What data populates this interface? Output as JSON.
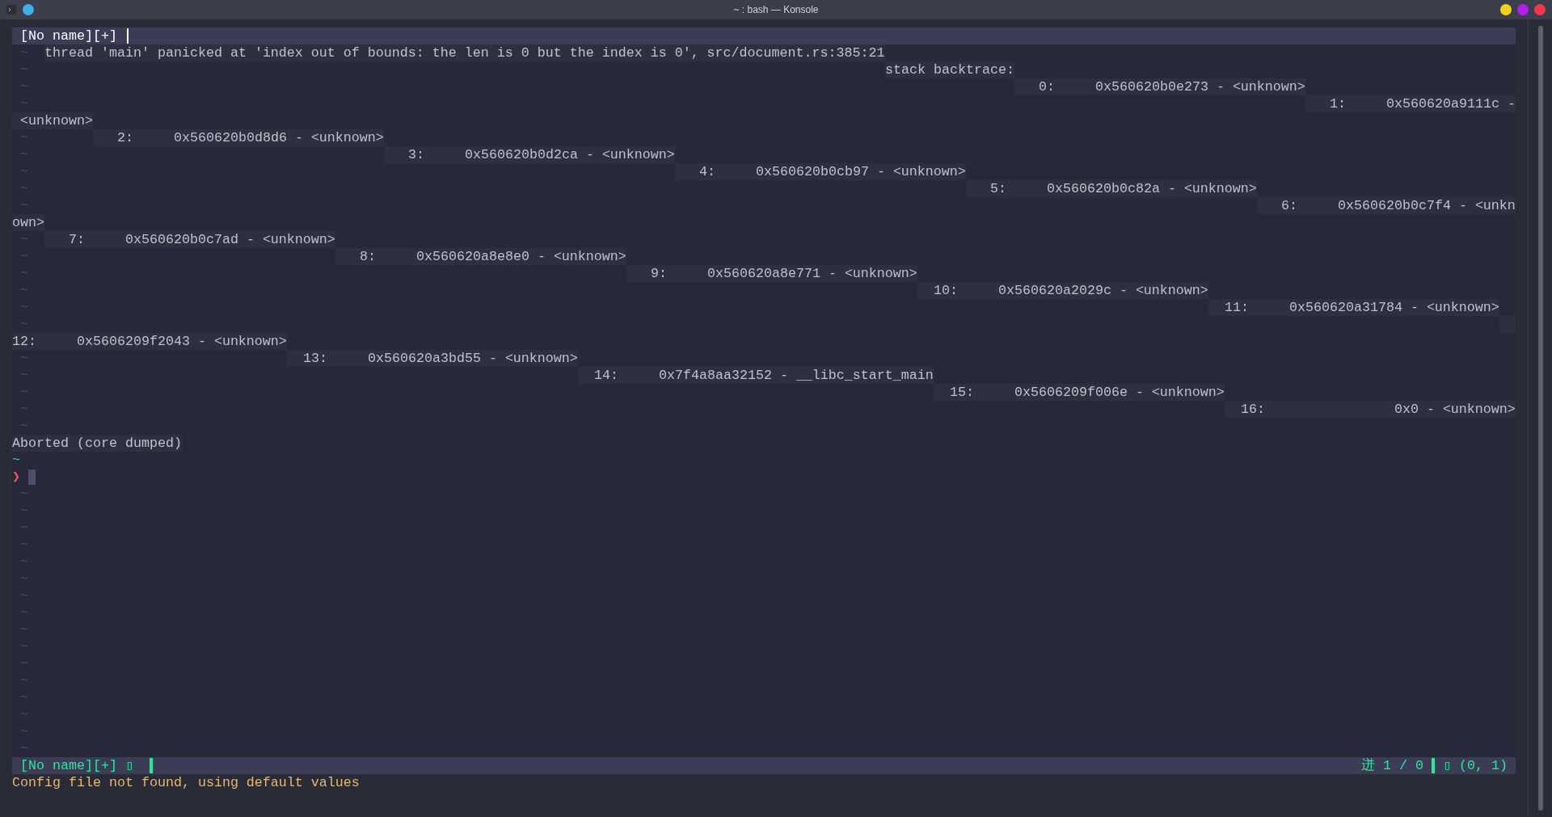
{
  "window": {
    "title": "~ : bash — Konsole"
  },
  "editor": {
    "tab": "[No name][+]",
    "rows": [
      {
        "tilde": "~",
        "output": "thread 'main' panicked at 'index out of bounds: the len is 0 but the index is 0', src/document.rs:385:21"
      },
      {
        "tilde": "~",
        "output": "stack backtrace:"
      },
      {
        "tilde": "~",
        "output": "   0:     0x560620b0e273 - <unknown>"
      },
      {
        "tilde": "~",
        "output": "   1:     0x560620a9111c -"
      },
      {
        "output": " <unknown>"
      },
      {
        "tilde": "~",
        "output": "   2:     0x560620b0d8d6 - <unknown>"
      },
      {
        "tilde": "~",
        "output": "   3:     0x560620b0d2ca - <unknown>"
      },
      {
        "tilde": "~",
        "output": "   4:     0x560620b0cb97 - <unknown>"
      },
      {
        "tilde": "~",
        "output": "   5:     0x560620b0c82a - <unknown>"
      },
      {
        "tilde": "~",
        "output": "   6:     0x560620b0c7f4 - <unkn"
      },
      {
        "output": "own>"
      },
      {
        "tilde": "~",
        "output": "   7:     0x560620b0c7ad - <unknown>"
      },
      {
        "tilde": "~",
        "output": "   8:     0x560620a8e8e0 - <unknown>"
      },
      {
        "tilde": "~",
        "output": "   9:     0x560620a8e771 - <unknown>"
      },
      {
        "tilde": "~",
        "output": "  10:     0x560620a2029c - <unknown>"
      },
      {
        "tilde": "~",
        "output": "  11:     0x560620a31784 - <unknown>"
      },
      {
        "tilde": "~"
      },
      {
        "output": "12:     0x5606209f2043 - <unknown>"
      },
      {
        "tilde": "~",
        "output": "  13:     0x560620a3bd55 - <unknown>"
      },
      {
        "tilde": "~",
        "output": "  14:     0x7f4a8aa32152 - __libc_start_main"
      },
      {
        "tilde": "~",
        "output": "  15:     0x5606209f006e - <unknown>"
      },
      {
        "tilde": "~",
        "output": "  16:                0x0 - <unknown>"
      },
      {
        "tilde": "~"
      },
      {
        "output": "Aborted (core dumped)"
      }
    ],
    "prompt": {
      "directory": "~",
      "symbol": "❯"
    },
    "trailing_rows": [
      "~",
      "~",
      "~",
      "~",
      "~",
      "~",
      "~",
      "~",
      "~",
      "~",
      "~",
      "~",
      "~",
      "~",
      "~",
      "~"
    ]
  },
  "status_bar": {
    "file": "[No name][+] ▯",
    "position": "迸 1 / 0",
    "cursor": "▯ (0, 1)"
  },
  "message": "Config file not found, using default values"
}
